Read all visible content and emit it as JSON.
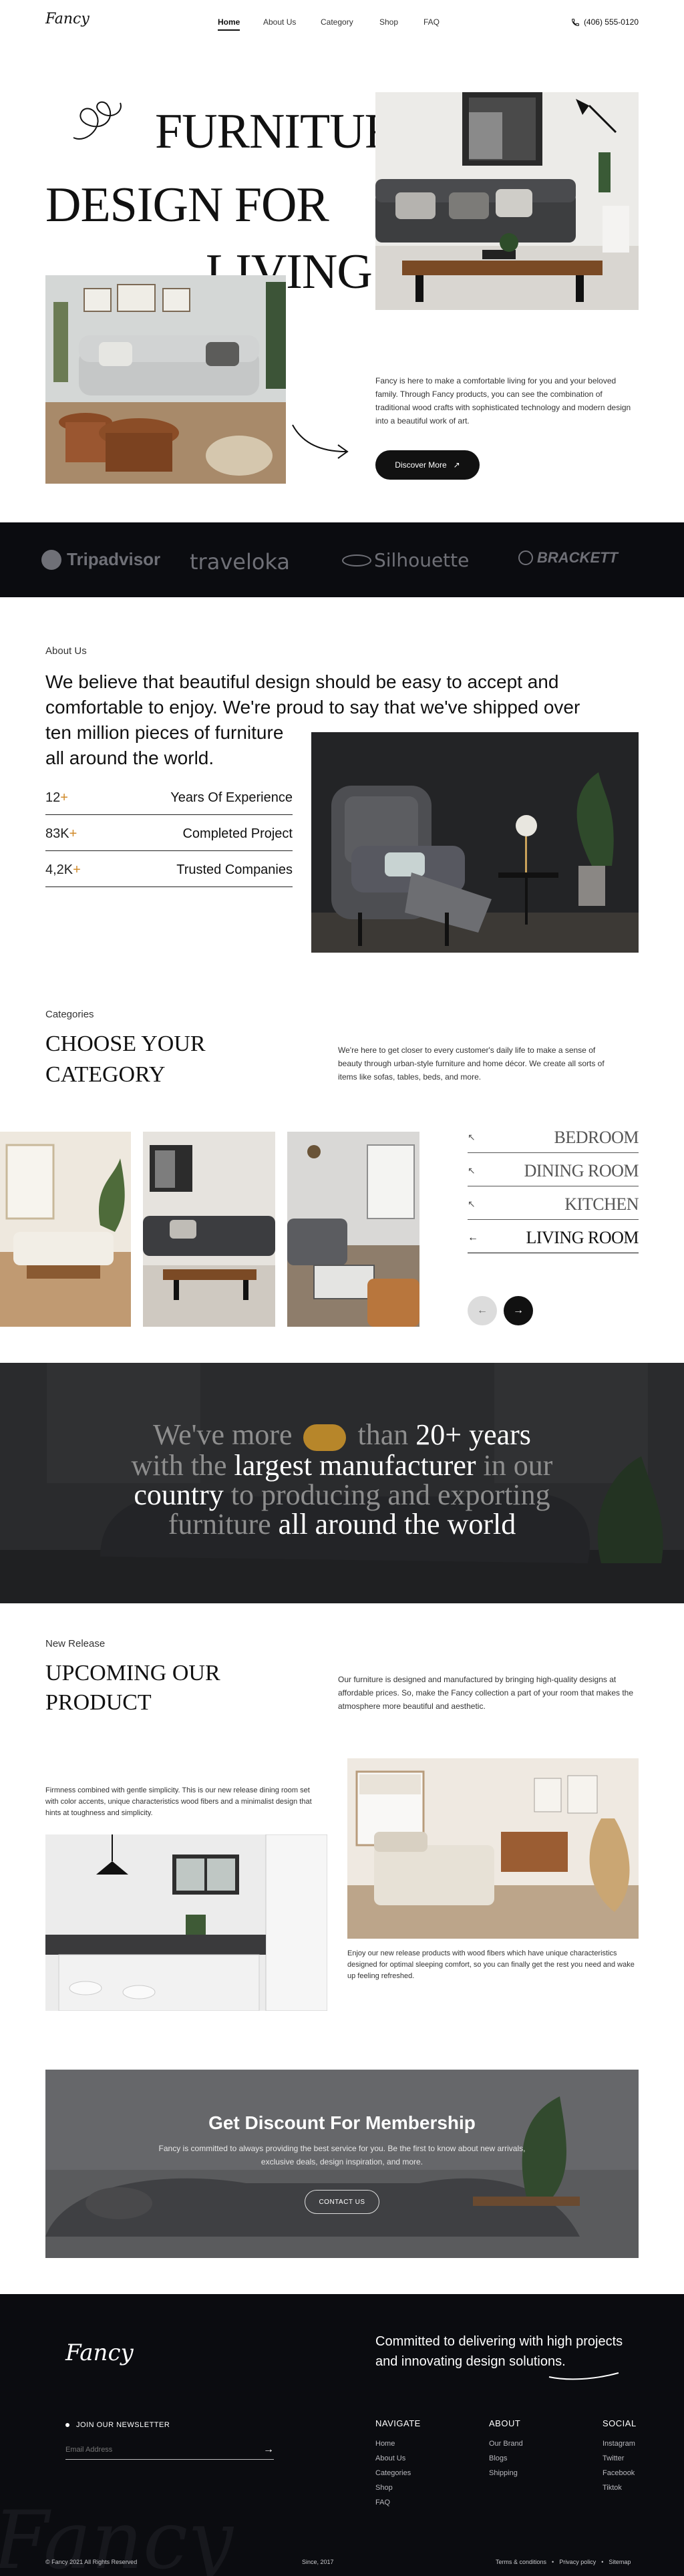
{
  "nav": {
    "logo": "Fancy",
    "links": [
      "Home",
      "About Us",
      "Category",
      "Shop",
      "FAQ"
    ],
    "phone": "(406) 555-0120"
  },
  "hero": {
    "title_line1": "FURNITURE",
    "title_line2": "DESIGN FOR",
    "title_line3": "LIVING",
    "description": "Fancy is here to make a comfortable living for you and your beloved family. Through Fancy products, you can see the combination of traditional wood crafts with sophisticated technology and modern design into a beautiful work of art.",
    "cta": "Discover More"
  },
  "brands": [
    "Tripadvisor",
    "traveloka",
    "Silhouette",
    "BRACKETT"
  ],
  "about": {
    "eyebrow": "About Us",
    "heading_a": "We believe that beautiful design should be easy to accept and comfortable to enjoy. We're proud to say that we've shipped over",
    "heading_b": "ten million pieces of furniture",
    "heading_c": "all around the world.",
    "stats": [
      {
        "value": "12",
        "plus": "+",
        "label": "Years Of Experience"
      },
      {
        "value": "83K",
        "plus": "+",
        "label": "Completed Project"
      },
      {
        "value": "4,2K",
        "plus": "+",
        "label": "Trusted Companies"
      }
    ]
  },
  "categories": {
    "eyebrow": "Categories",
    "title_line1": "CHOOSE YOUR",
    "title_line2": "CATEGORY",
    "description": "We're here to get closer to every customer's daily life to make a sense of beauty through urban-style furniture and home décor. We create all sorts of items like sofas, tables, beds, and more.",
    "items": [
      "BEDROOM",
      "DINING ROOM",
      "KITCHEN",
      "LIVING ROOM"
    ]
  },
  "statement": {
    "p1": "We've more",
    "p2": "than",
    "p3": "20+ years",
    "p4": "with the",
    "p5": "largest manufacturer",
    "p6": "in our",
    "p7": "country",
    "p8": "to producing and exporting",
    "p9": "furniture",
    "p10": "all around the world"
  },
  "release": {
    "eyebrow": "New Release",
    "title_line1": "UPCOMING OUR",
    "title_line2": "PRODUCT",
    "description": "Our furniture is designed and manufactured by bringing high-quality designs at affordable prices. So, make the Fancy collection a part of your room that makes the atmosphere more beautiful and aesthetic.",
    "left_caption": "Firmness combined with gentle simplicity. This is our new release dining room set with color accents, unique characteristics wood fibers and a minimalist design that hints at toughness and simplicity.",
    "right_caption": "Enjoy our new release products with wood fibers which have unique characteristics designed for optimal sleeping comfort, so you can finally get the rest you need and wake up feeling refreshed."
  },
  "membership": {
    "title": "Get Discount For Membership",
    "text": "Fancy is committed to always providing the best service for you. Be the first to know about new arrivals, exclusive deals, design inspiration, and more.",
    "cta": "CONTACT US"
  },
  "footer": {
    "logo": "Fancy",
    "tagline": "Committed to delivering with high projects and innovating design solutions.",
    "newsletter_label": "JOIN OUR NEWSLETTER",
    "email_placeholder": "Email Address",
    "navigate": {
      "title": "NAVIGATE",
      "links": [
        "Home",
        "About Us",
        "Categories",
        "Shop",
        "FAQ"
      ]
    },
    "about": {
      "title": "ABOUT",
      "links": [
        "Our Brand",
        "Blogs",
        "Shipping"
      ]
    },
    "social": {
      "title": "SOCIAL",
      "links": [
        "Instagram",
        "Twitter",
        "Facebook",
        "Tiktok"
      ]
    },
    "copyright": "© Fancy 2021 All Rights Reserved",
    "since": "Since, 2017",
    "legal": [
      "Terms & conditions",
      "Privacy policy",
      "Sitemap"
    ]
  }
}
